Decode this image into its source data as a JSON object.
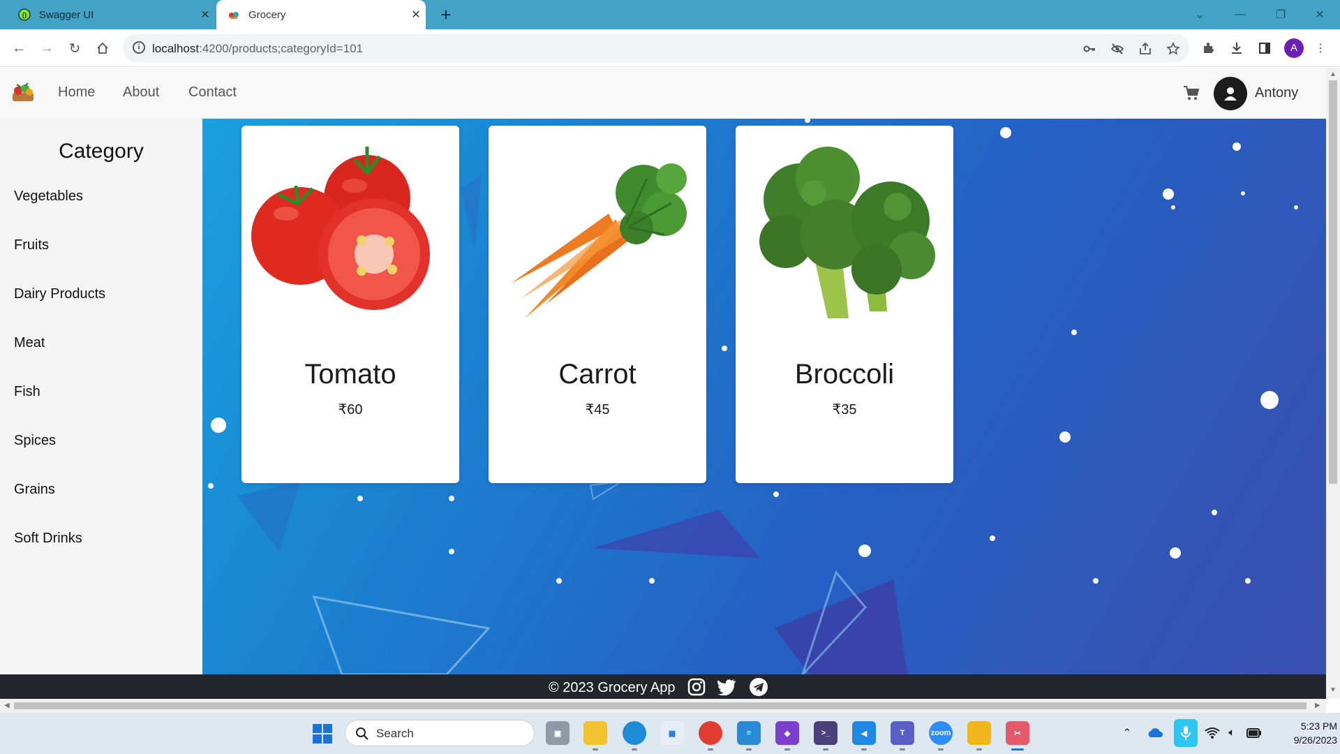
{
  "browser": {
    "tabs": [
      {
        "title": "Swagger UI",
        "active": false
      },
      {
        "title": "Grocery",
        "active": true
      }
    ],
    "url_host": "localhost",
    "url_rest": ":4200/products;categoryId=101"
  },
  "header": {
    "nav": [
      "Home",
      "About",
      "Contact"
    ],
    "username": "Antony"
  },
  "sidebar": {
    "title": "Category",
    "items": [
      "Vegetables",
      "Fruits",
      "Dairy Products",
      "Meat",
      "Fish",
      "Spices",
      "Grains",
      "Soft Drinks"
    ]
  },
  "products": [
    {
      "name": "Tomato",
      "price": "₹60",
      "icon": "tomato-image"
    },
    {
      "name": "Carrot",
      "price": "₹45",
      "icon": "carrot-image"
    },
    {
      "name": "Broccoli",
      "price": "₹35",
      "icon": "broccoli-image"
    }
  ],
  "footer": {
    "copyright": "© 2023 Grocery App",
    "social": [
      "instagram-icon",
      "twitter-icon",
      "telegram-icon"
    ]
  },
  "taskbar": {
    "search_label": "Search",
    "time": "5:23 PM",
    "date": "9/26/2023"
  },
  "colors": {
    "tabstrip": "#43a3c4",
    "footer": "#23252a",
    "main_gradient_start": "#1aa0e0",
    "main_gradient_end": "#3a4fb0"
  }
}
